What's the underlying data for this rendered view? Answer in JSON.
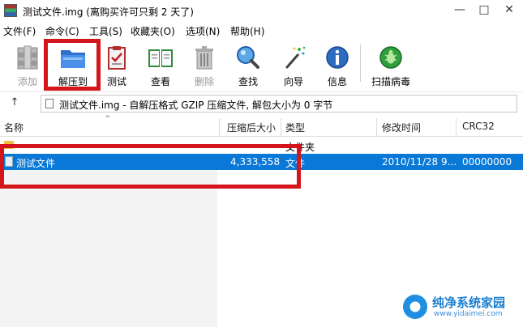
{
  "window": {
    "title": "测试文件.img (离购买许可只剩 2 天了)",
    "controls": [
      "—",
      "□",
      "✕"
    ]
  },
  "menu": [
    "文件(F)",
    "命令(C)",
    "工具(S)",
    "收藏夹(O)",
    "选项(N)",
    "帮助(H)"
  ],
  "toolbar": {
    "buttons": [
      {
        "label": "添加",
        "icon": "add-archive-icon",
        "enabled": false
      },
      {
        "label": "解压到",
        "icon": "extract-folder-icon",
        "enabled": true,
        "highlighted": true
      },
      {
        "label": "测试",
        "icon": "test-clipboard-icon",
        "enabled": true
      },
      {
        "label": "查看",
        "icon": "view-book-icon",
        "enabled": true
      },
      {
        "label": "删除",
        "icon": "trash-icon",
        "enabled": false
      },
      {
        "label": "查找",
        "icon": "magnifier-icon",
        "enabled": true
      },
      {
        "label": "向导",
        "icon": "wizard-wand-icon",
        "enabled": true
      },
      {
        "label": "信息",
        "icon": "info-icon",
        "enabled": true
      },
      {
        "label": "扫描病毒",
        "icon": "virus-scan-icon",
        "enabled": true
      }
    ]
  },
  "address": {
    "up_glyph": "↑",
    "text": "测试文件.img - 自解压格式 GZIP 压缩文件, 解包大小为 0 字节"
  },
  "list": {
    "columns": [
      "名称",
      "压缩后大小",
      "类型",
      "修改时间",
      "CRC32"
    ],
    "sort_glyph": "^",
    "rows": [
      {
        "name": "",
        "size": "",
        "type": "文件夹",
        "modified": "",
        "crc": "",
        "icon": "folder-icon",
        "selected": false
      },
      {
        "name": "测试文件",
        "size": "4,333,558",
        "type": "文件",
        "modified": "2010/11/28 9...",
        "crc": "00000000",
        "icon": "file-icon",
        "selected": true
      }
    ]
  },
  "watermark": {
    "title": "纯净系统家园",
    "url": "www.yidaimei.com"
  },
  "colors": {
    "highlight_red": "#d4161c",
    "selection_blue": "#0a78d7"
  }
}
